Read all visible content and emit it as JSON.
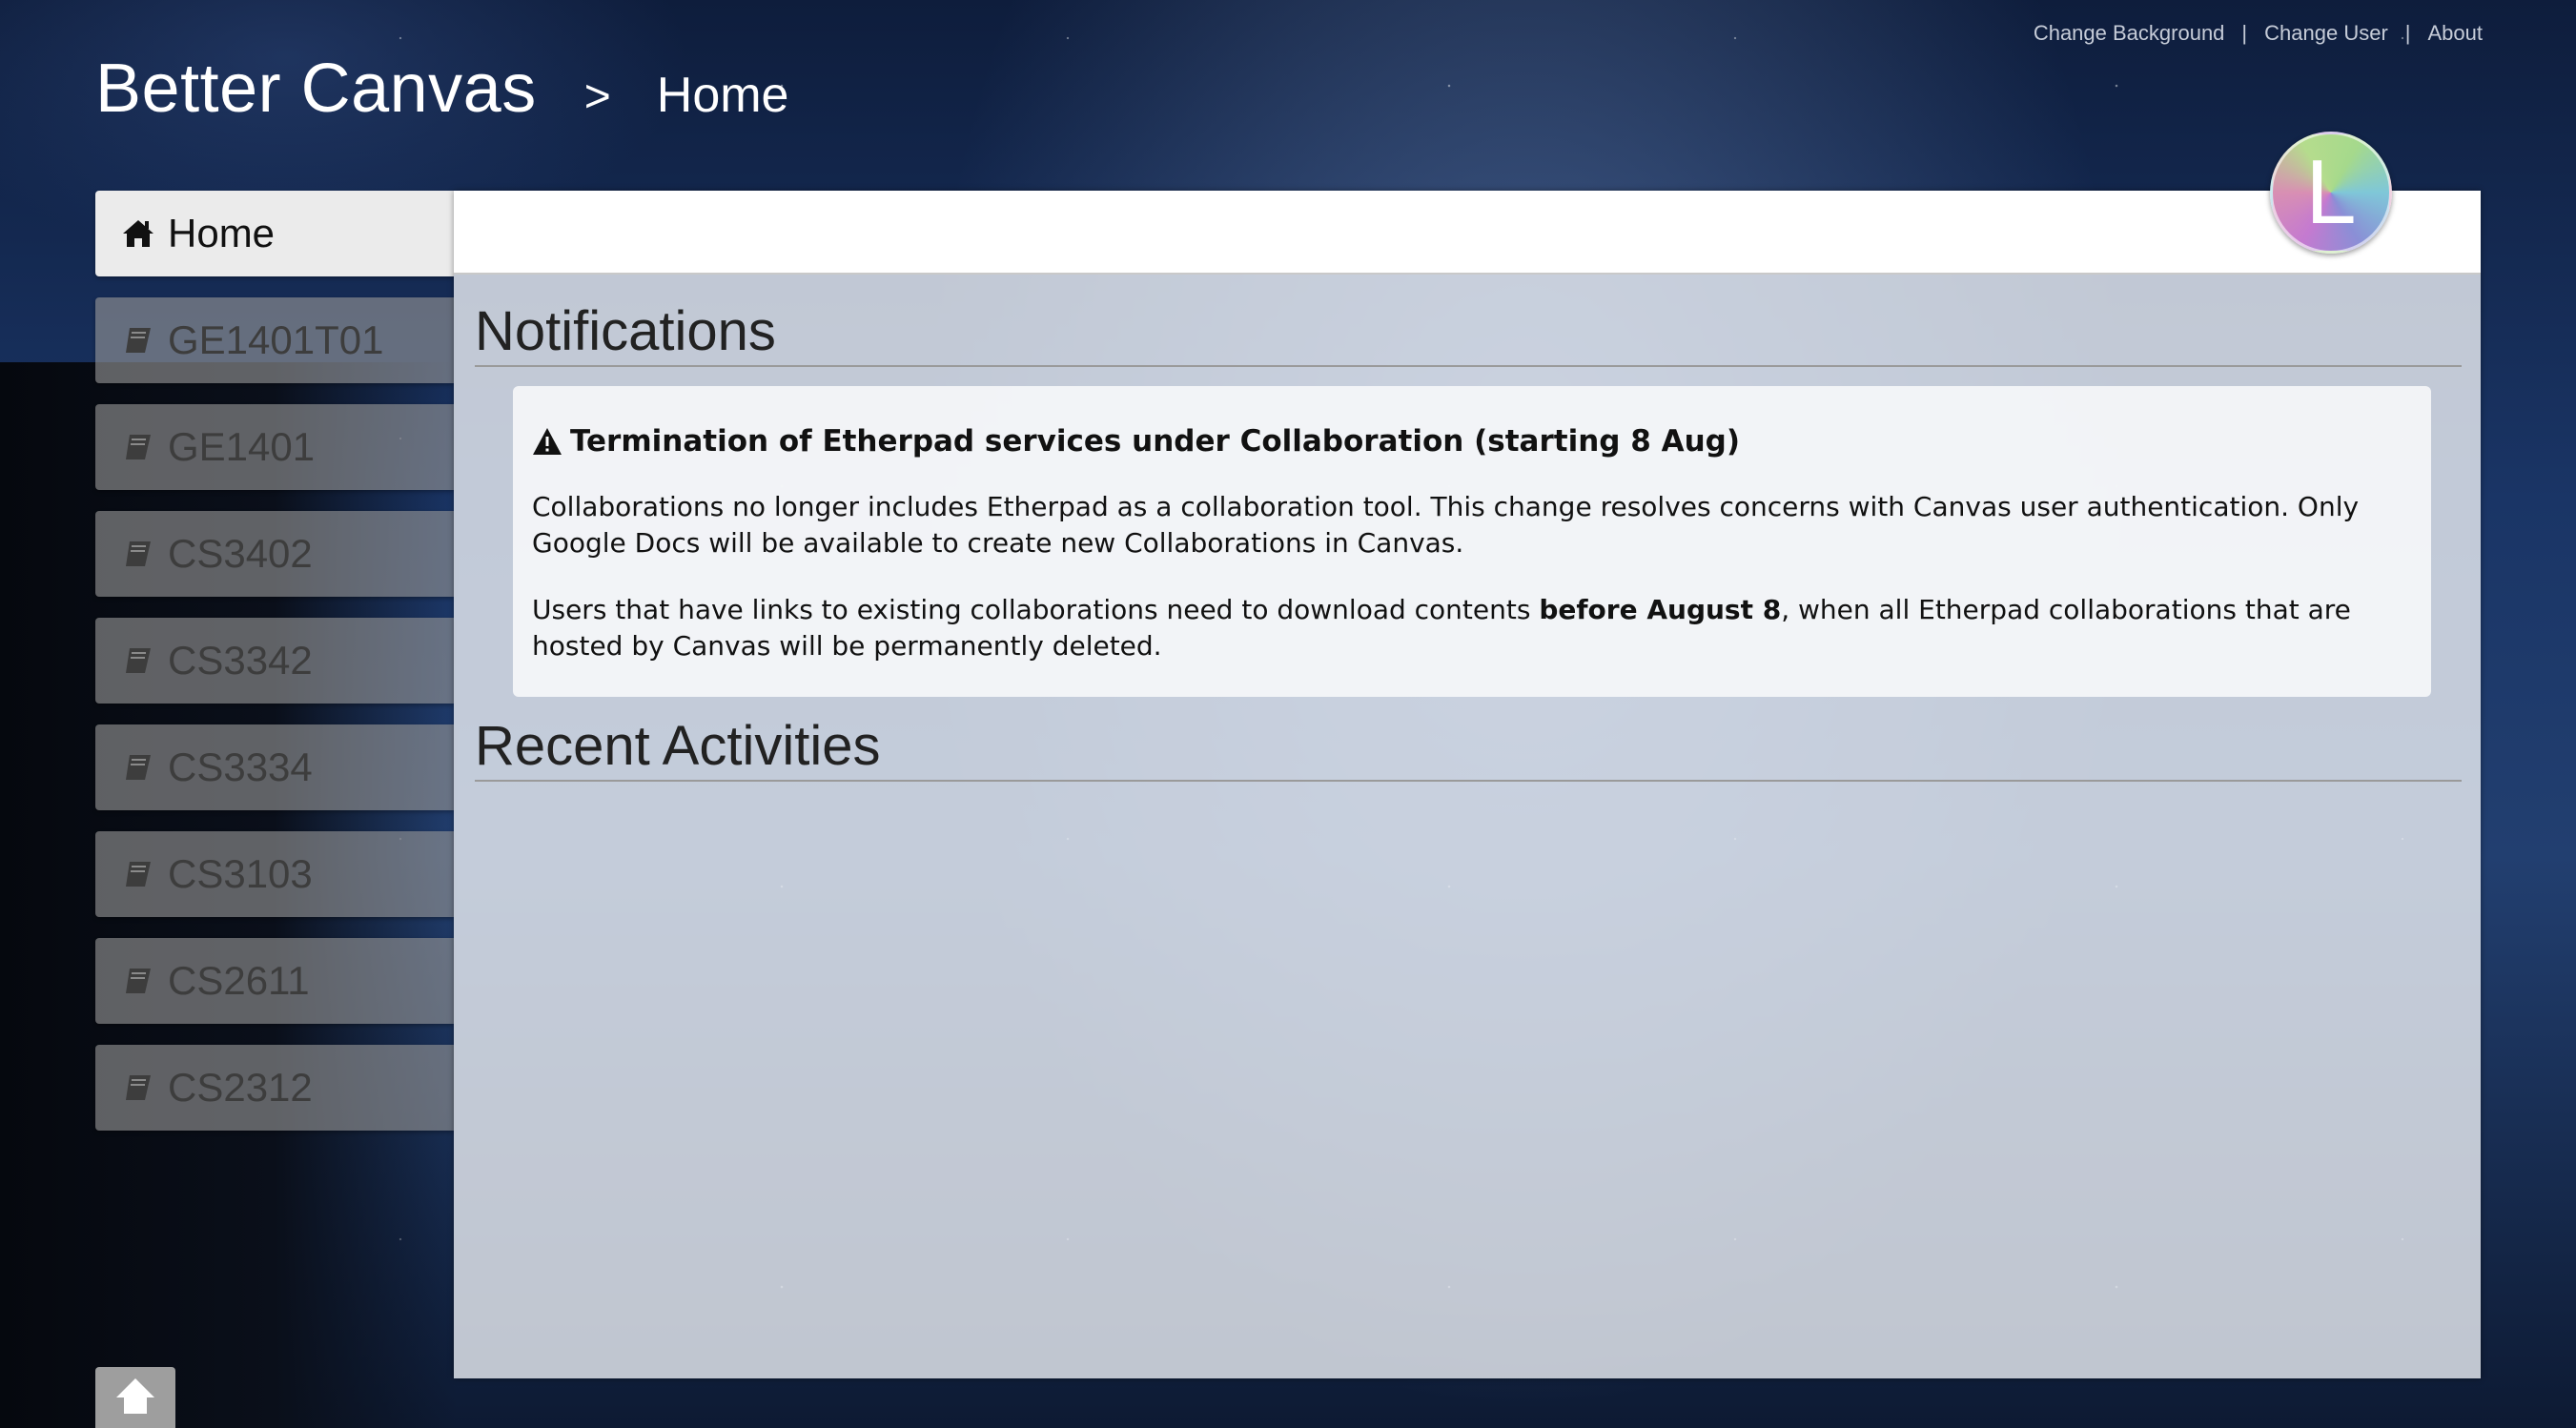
{
  "header": {
    "links": [
      {
        "label": "Change Background"
      },
      {
        "label": "Change User"
      },
      {
        "label": "About"
      }
    ],
    "separator": "|",
    "brand": "Better Canvas",
    "breadcrumb_separator": ">",
    "current_page": "Home"
  },
  "sidebar": {
    "items": [
      {
        "label": "Home",
        "icon": "home-icon",
        "active": true
      },
      {
        "label": "GE1401T01",
        "icon": "book-icon",
        "active": false
      },
      {
        "label": "GE1401",
        "icon": "book-icon",
        "active": false
      },
      {
        "label": "CS3402",
        "icon": "book-icon",
        "active": false
      },
      {
        "label": "CS3342",
        "icon": "book-icon",
        "active": false
      },
      {
        "label": "CS3334",
        "icon": "book-icon",
        "active": false
      },
      {
        "label": "CS3103",
        "icon": "book-icon",
        "active": false
      },
      {
        "label": "CS2611",
        "icon": "book-icon",
        "active": false
      },
      {
        "label": "CS2312",
        "icon": "book-icon",
        "active": false
      }
    ]
  },
  "user": {
    "avatar_letter": "L"
  },
  "main": {
    "notifications_title": "Notifications",
    "notification": {
      "title": "Termination of Etherpad services under Collaboration (starting 8 Aug)",
      "icon": "warning-icon",
      "paragraph1": "Collaborations no longer includes Etherpad as a collaboration tool. This change resolves concerns with Canvas user authentication. Only Google Docs will be available to create new Collaborations in Canvas.",
      "paragraph2_before": "Users that have links to existing collaborations need to download contents ",
      "paragraph2_bold": "before August 8",
      "paragraph2_after": ", when all Etherpad collaborations that are hosted by Canvas will be permanently deleted."
    },
    "recent_activities_title": "Recent Activities"
  },
  "scroll_top": {
    "icon": "arrow-up-icon"
  },
  "colors": {
    "active_nav_bg": "#ebebeb",
    "nav_bg": "#969696",
    "panel_bg": "#e8ebf2"
  }
}
